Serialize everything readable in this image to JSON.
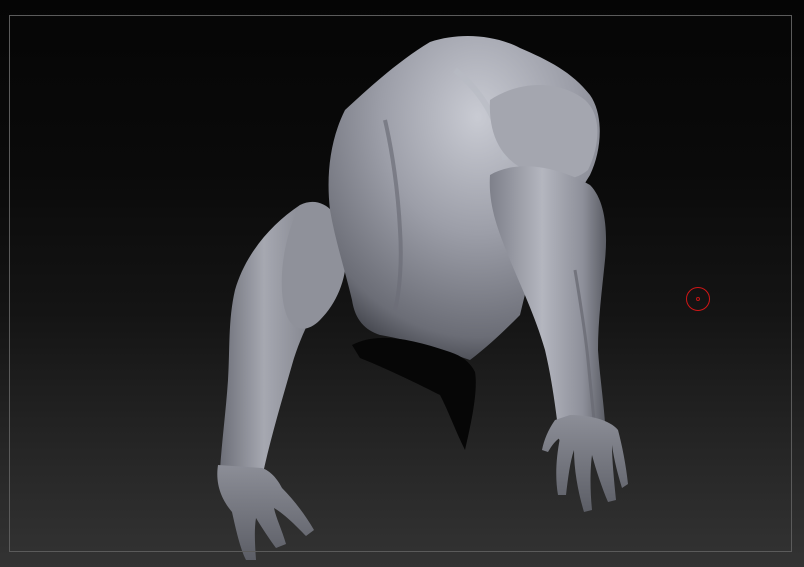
{
  "viewport": {
    "label": "",
    "colors": {
      "background_top": "#050505",
      "background_bottom": "#333333",
      "frame_border": "#5b5b5b",
      "clay_base": "#8e909a",
      "clay_highlight": "#c9cbd3",
      "clay_shadow": "#3d3f46",
      "cursor": "#d01616"
    }
  },
  "model": {
    "name": "",
    "material": "grey clay"
  },
  "cursor": {
    "icon": "brush-circle-icon"
  }
}
